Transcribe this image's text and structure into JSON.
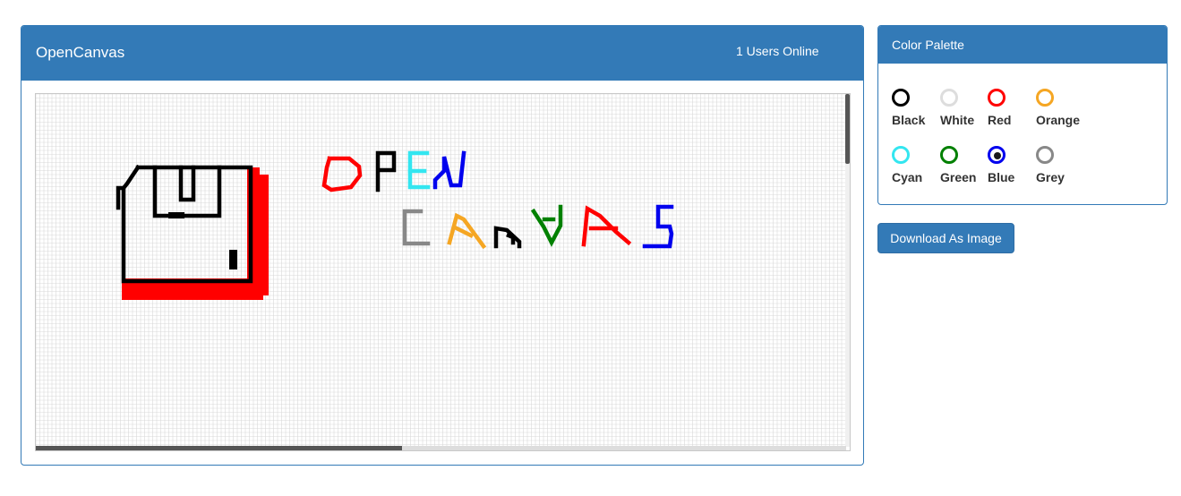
{
  "app": {
    "title": "OpenCanvas",
    "users_online": "1 Users Online"
  },
  "canvas": {
    "grid_line_color": "#d9d9d9",
    "background": "#ffffff"
  },
  "palette": {
    "title": "Color Palette",
    "selected": "Blue",
    "colors": [
      {
        "label": "Black",
        "hex": "#000000"
      },
      {
        "label": "White",
        "hex": "#dddddd"
      },
      {
        "label": "Red",
        "hex": "#ff0000"
      },
      {
        "label": "Orange",
        "hex": "#f5a623"
      },
      {
        "label": "Cyan",
        "hex": "#33e6f0"
      },
      {
        "label": "Green",
        "hex": "#008000"
      },
      {
        "label": "Blue",
        "hex": "#0000ee"
      },
      {
        "label": "Grey",
        "hex": "#888888"
      }
    ]
  },
  "actions": {
    "download_label": "Download As Image"
  },
  "colors": {
    "accent": "#337ab7",
    "accent_border": "#2e6da4"
  }
}
